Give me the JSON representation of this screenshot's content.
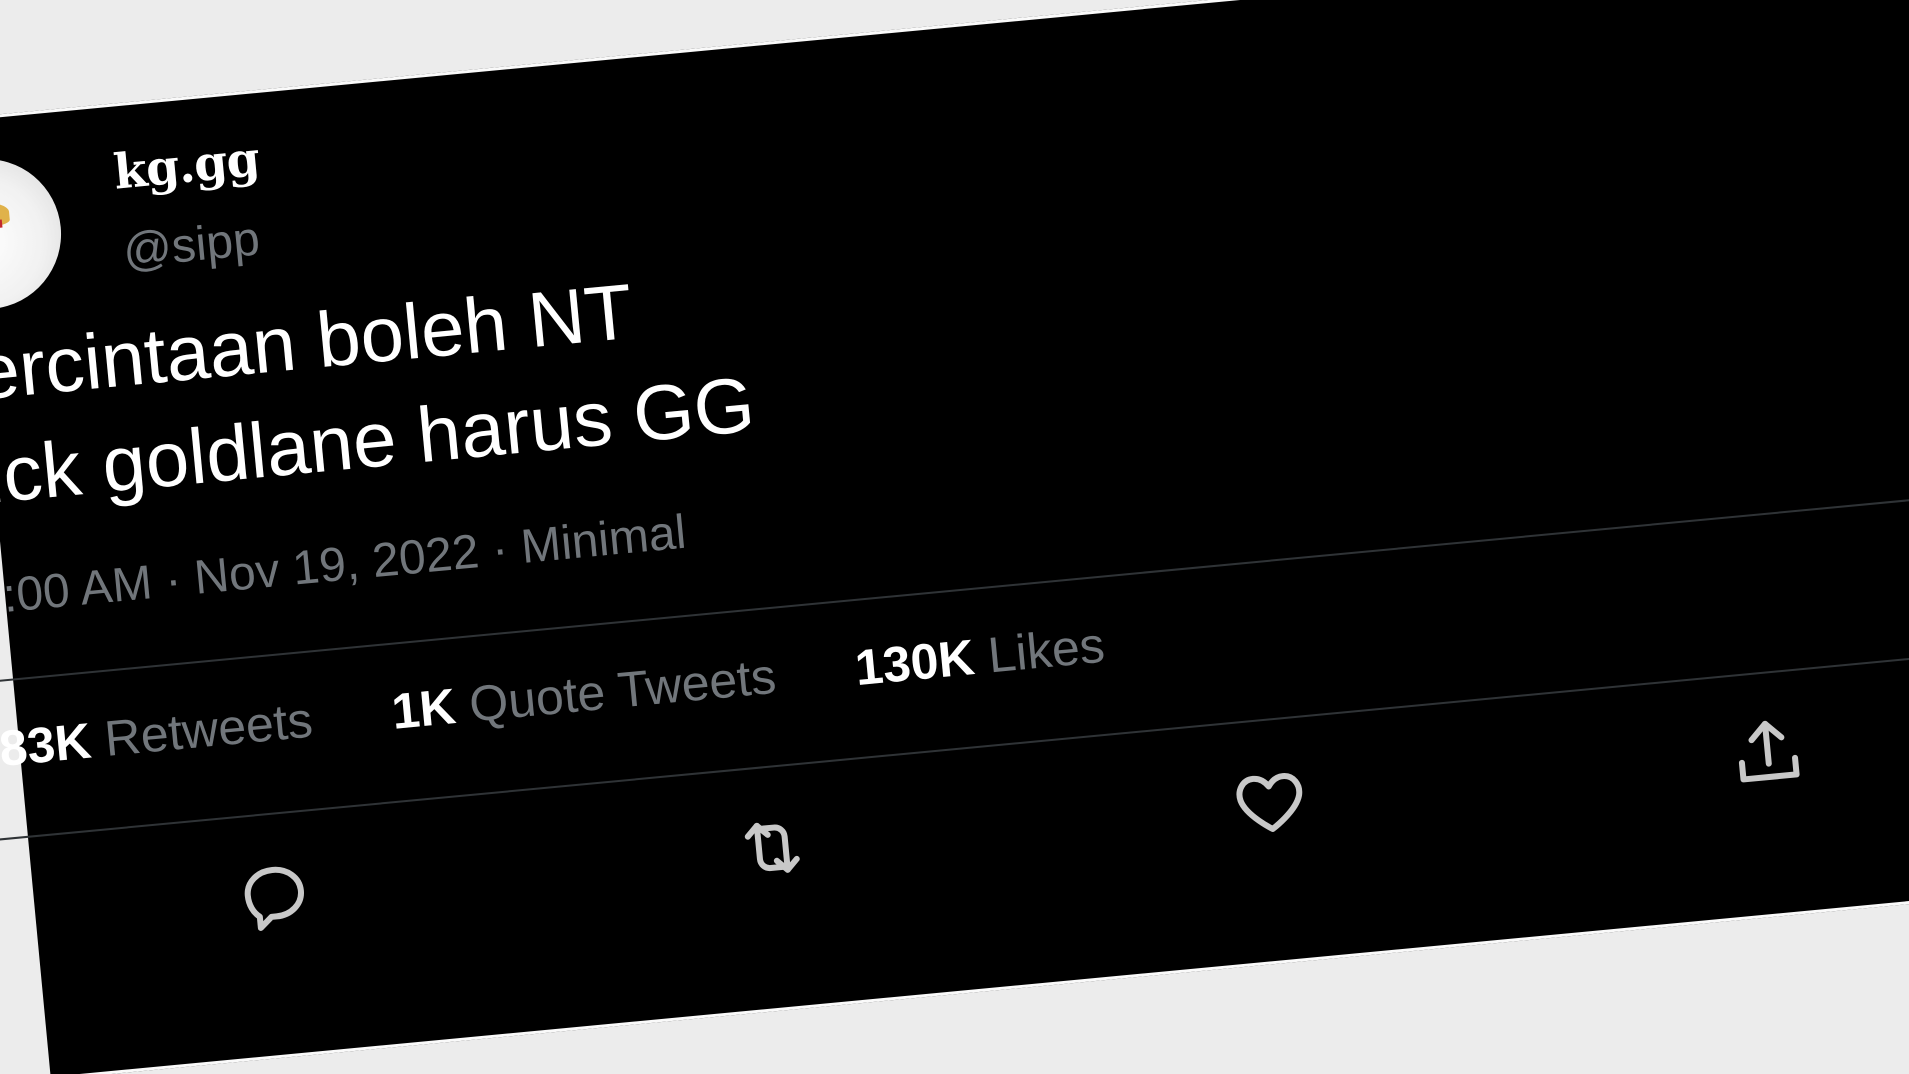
{
  "tweet": {
    "display_name": "kg.gg",
    "handle": "@sipp",
    "text": "ercintaan boleh NT\nick goldlane harus GG",
    "meta": ":00 AM · Nov 19, 2022 · Minimal"
  },
  "stats": {
    "retweets_count": "83K",
    "retweets_label": "Retweets",
    "quotes_count": "1K",
    "quotes_label": "Quote Tweets",
    "likes_count": "130K",
    "likes_label": "Likes"
  },
  "actions": {
    "reply_icon": "reply-icon",
    "retweet_icon": "retweet-icon",
    "like_icon": "heart-icon",
    "share_icon": "share-icon"
  },
  "colors": {
    "background": "#000000",
    "text_primary": "#ffffff",
    "text_secondary": "#71767b",
    "divider": "#2f3336",
    "page": "#ececec"
  }
}
